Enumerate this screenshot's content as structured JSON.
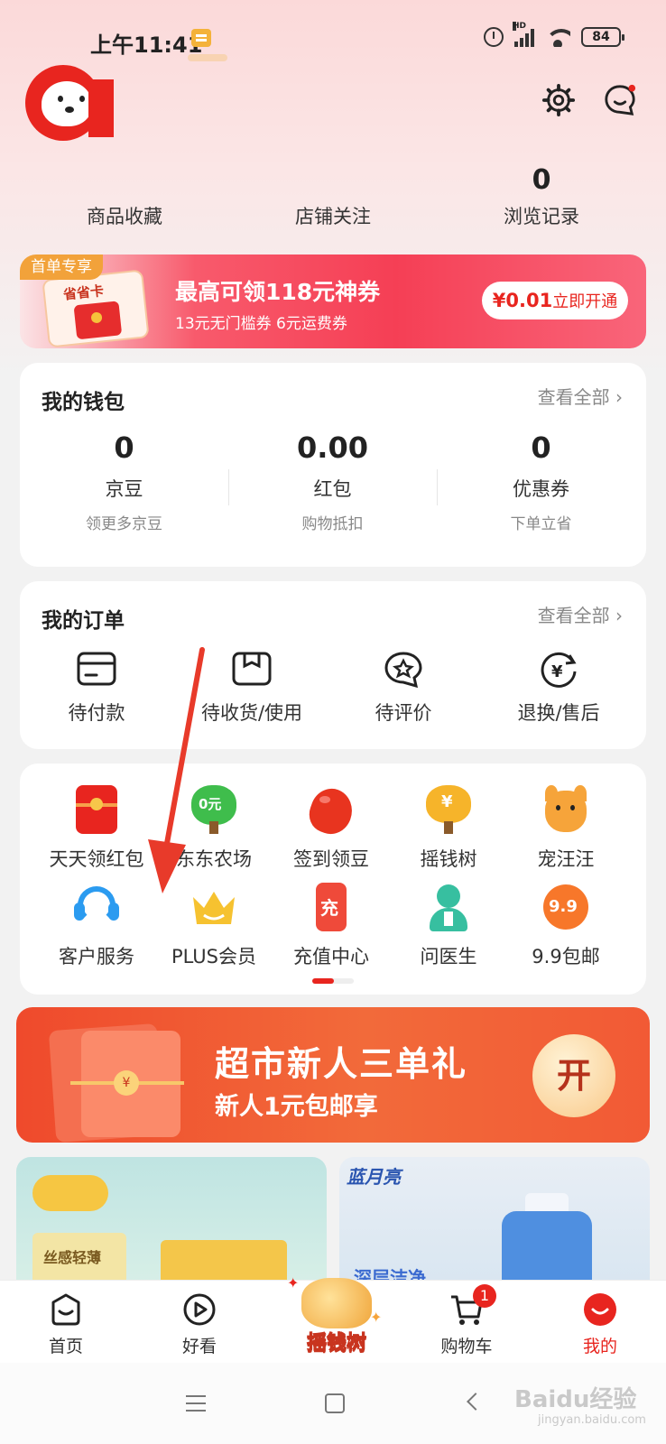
{
  "status_bar": {
    "time": "上午11:41",
    "battery": "84",
    "signal_label": "HD"
  },
  "header": {
    "icons": [
      "settings-gear-icon",
      "message-chat-icon"
    ]
  },
  "stats": [
    {
      "value": "",
      "label": "商品收藏"
    },
    {
      "value": "",
      "label": "店铺关注"
    },
    {
      "value": "0",
      "label": "浏览记录"
    }
  ],
  "promo": {
    "tag": "首单专享",
    "card_label": "省省卡",
    "title": "最高可领118元神券",
    "subtitle": "13元无门槛券 6元运费券",
    "price": "¥0.01",
    "button": "立即开通"
  },
  "wallet": {
    "title": "我的钱包",
    "more": "查看全部",
    "items": [
      {
        "value": "0",
        "name": "京豆",
        "sub": "领更多京豆"
      },
      {
        "value": "0.00",
        "name": "红包",
        "sub": "购物抵扣"
      },
      {
        "value": "0",
        "name": "优惠券",
        "sub": "下单立省"
      }
    ]
  },
  "orders": {
    "title": "我的订单",
    "more": "查看全部",
    "items": [
      {
        "name": "待付款",
        "icon": "card-icon"
      },
      {
        "name": "待收货/使用",
        "icon": "package-icon"
      },
      {
        "name": "待评价",
        "icon": "star-chat-icon"
      },
      {
        "name": "退换/售后",
        "icon": "refund-icon"
      }
    ]
  },
  "services": {
    "row1": [
      {
        "name": "天天领红包",
        "icon": "red-envelope-icon"
      },
      {
        "name": "东东农场",
        "icon": "farm-tree-icon",
        "badge": "0元"
      },
      {
        "name": "签到领豆",
        "icon": "bean-icon"
      },
      {
        "name": "摇钱树",
        "icon": "money-tree-icon"
      },
      {
        "name": "宠汪汪",
        "icon": "dog-icon"
      }
    ],
    "row2": [
      {
        "name": "客户服务",
        "icon": "headset-icon"
      },
      {
        "name": "PLUS会员",
        "icon": "crown-icon"
      },
      {
        "name": "充值中心",
        "icon": "recharge-phone-icon",
        "badge": "充"
      },
      {
        "name": "问医生",
        "icon": "doctor-icon"
      },
      {
        "name": "9.9包邮",
        "icon": "price-tag-icon",
        "badge": "9.9"
      }
    ]
  },
  "market_banner": {
    "title": "超市新人三单礼",
    "subtitle": "新人1元包邮享",
    "open_button": "开",
    "coin": "¥"
  },
  "tiles": {
    "a_product_text": "丝感轻薄",
    "b_brand": "蓝月亮",
    "b_text": "深层洁净"
  },
  "bottom_nav": {
    "items": [
      {
        "name": "首页"
      },
      {
        "name": "好看"
      },
      {
        "name": "摇钱树"
      },
      {
        "name": "购物车",
        "badge": "1"
      },
      {
        "name": "我的"
      }
    ]
  },
  "watermark": {
    "main": "Baidu经验",
    "sub": "jingyan.baidu.com"
  },
  "colors": {
    "brand_red": "#e8251f",
    "annotation_arrow": "#e83a2a"
  }
}
